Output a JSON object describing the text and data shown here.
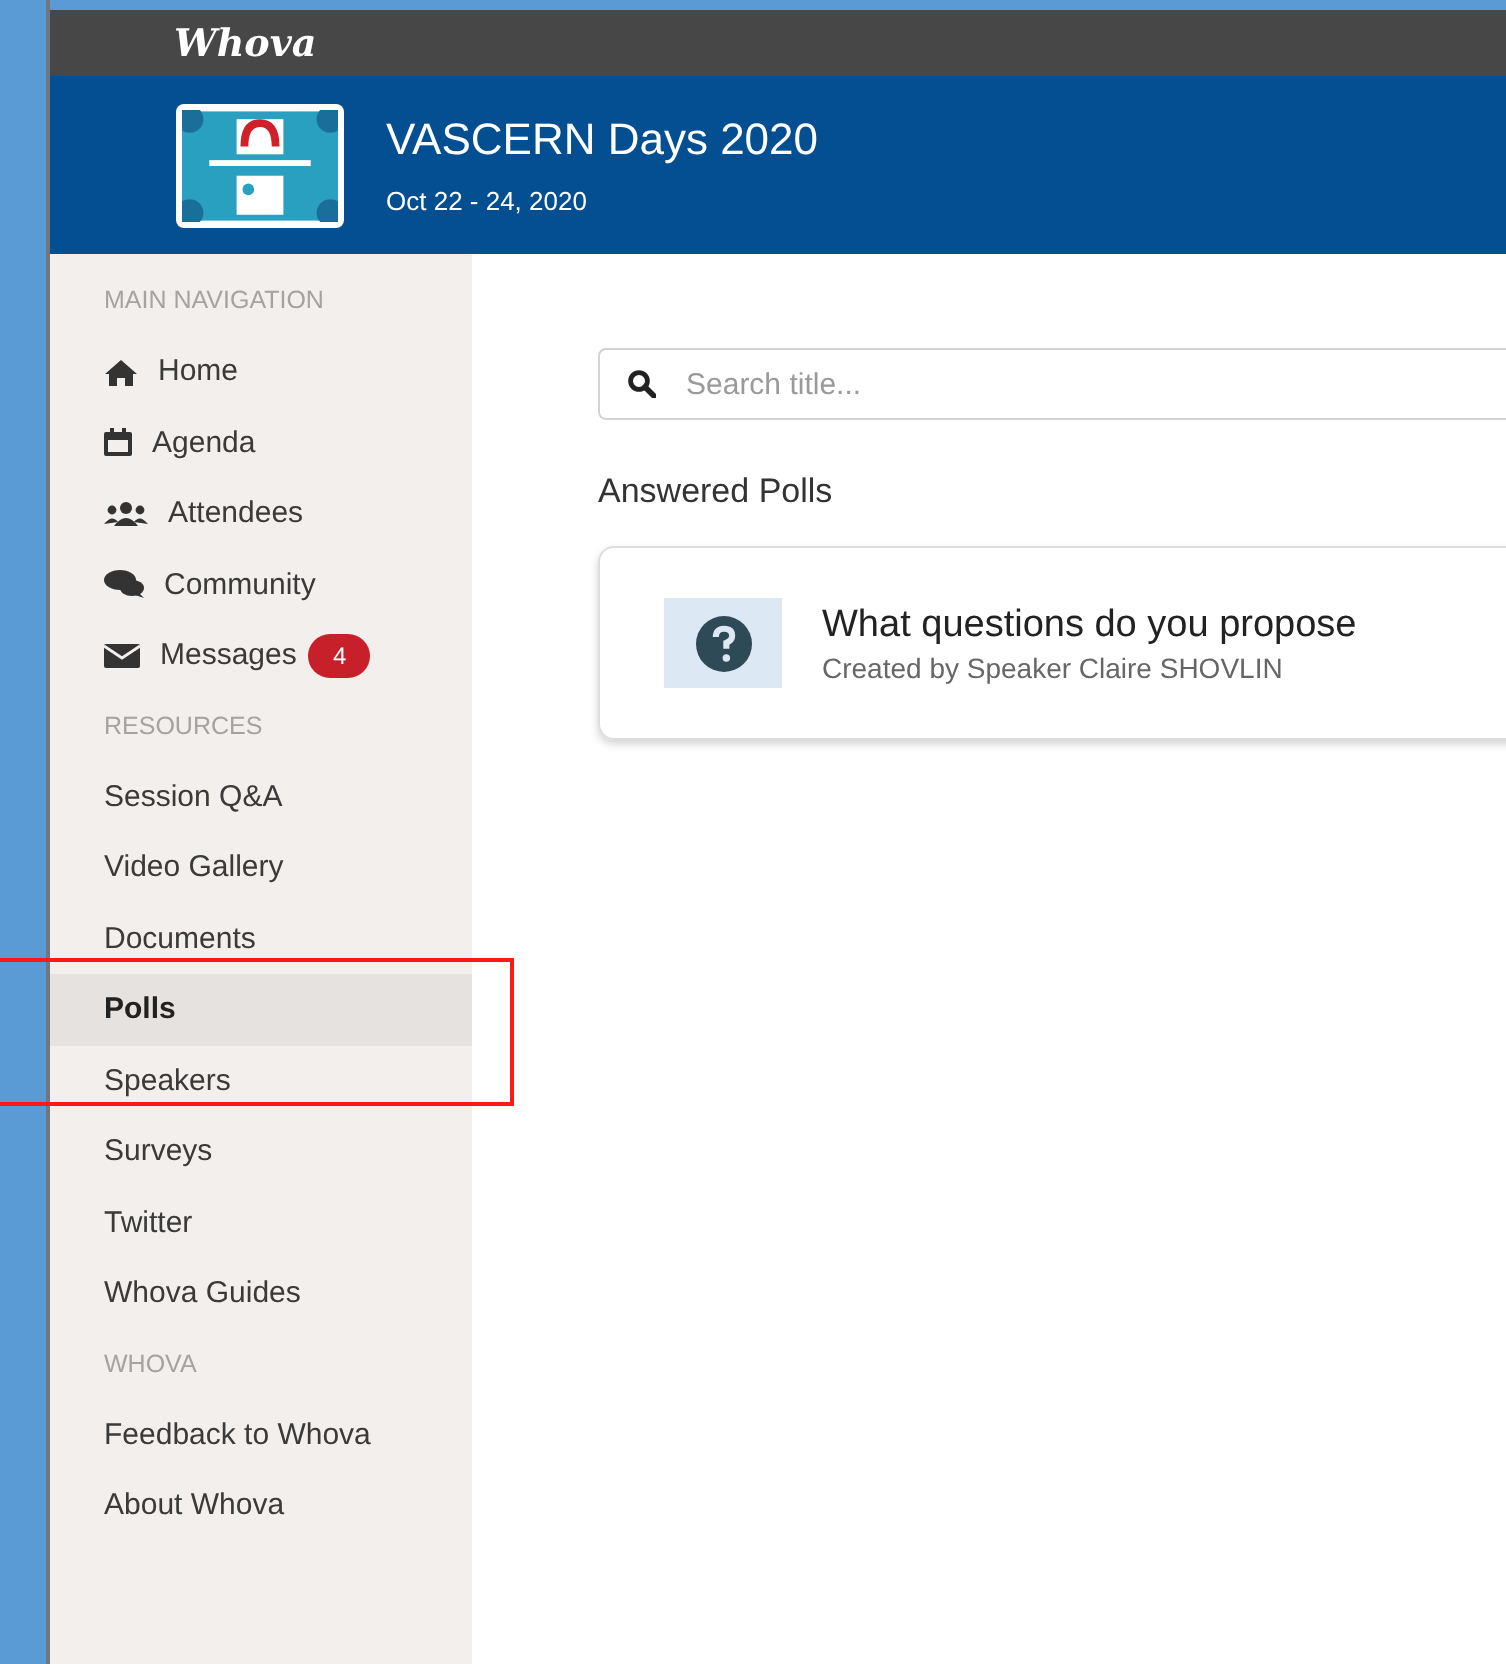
{
  "app_bar": {
    "brand": "Whova"
  },
  "event": {
    "title": "VASCERN Days 2020",
    "dates": "Oct 22 - 24, 2020"
  },
  "sidebar": {
    "sections": [
      {
        "title": "MAIN NAVIGATION",
        "items": [
          {
            "label": "Home",
            "kind": "icon-link",
            "selected": false
          },
          {
            "label": "Agenda",
            "kind": "icon-link",
            "selected": false
          },
          {
            "label": "Attendees",
            "kind": "icon-link",
            "selected": false
          },
          {
            "label": "Community",
            "kind": "icon-link",
            "selected": false
          },
          {
            "label": "Messages",
            "kind": "icon-link",
            "selected": false,
            "badge": "4"
          }
        ]
      },
      {
        "title": "RESOURCES",
        "items": [
          {
            "label": "Session Q&A",
            "kind": "link",
            "selected": false
          },
          {
            "label": "Video Gallery",
            "kind": "link",
            "selected": false
          },
          {
            "label": "Documents",
            "kind": "link",
            "selected": false
          },
          {
            "label": "Polls",
            "kind": "link",
            "selected": true
          },
          {
            "label": "Speakers",
            "kind": "link",
            "selected": false
          },
          {
            "label": "Surveys",
            "kind": "link",
            "selected": false
          },
          {
            "label": "Twitter",
            "kind": "link",
            "selected": false
          },
          {
            "label": "Whova Guides",
            "kind": "link",
            "selected": false
          }
        ]
      },
      {
        "title": "WHOVA",
        "items": [
          {
            "label": "Feedback to Whova",
            "kind": "link",
            "selected": false
          },
          {
            "label": "About Whova",
            "kind": "link",
            "selected": false
          }
        ]
      }
    ]
  },
  "search": {
    "placeholder": "Search title..."
  },
  "section_heading": "Answered Polls",
  "polls": [
    {
      "question": "What questions do you propose",
      "author": "Created by Speaker Claire SHOVLIN"
    }
  ]
}
